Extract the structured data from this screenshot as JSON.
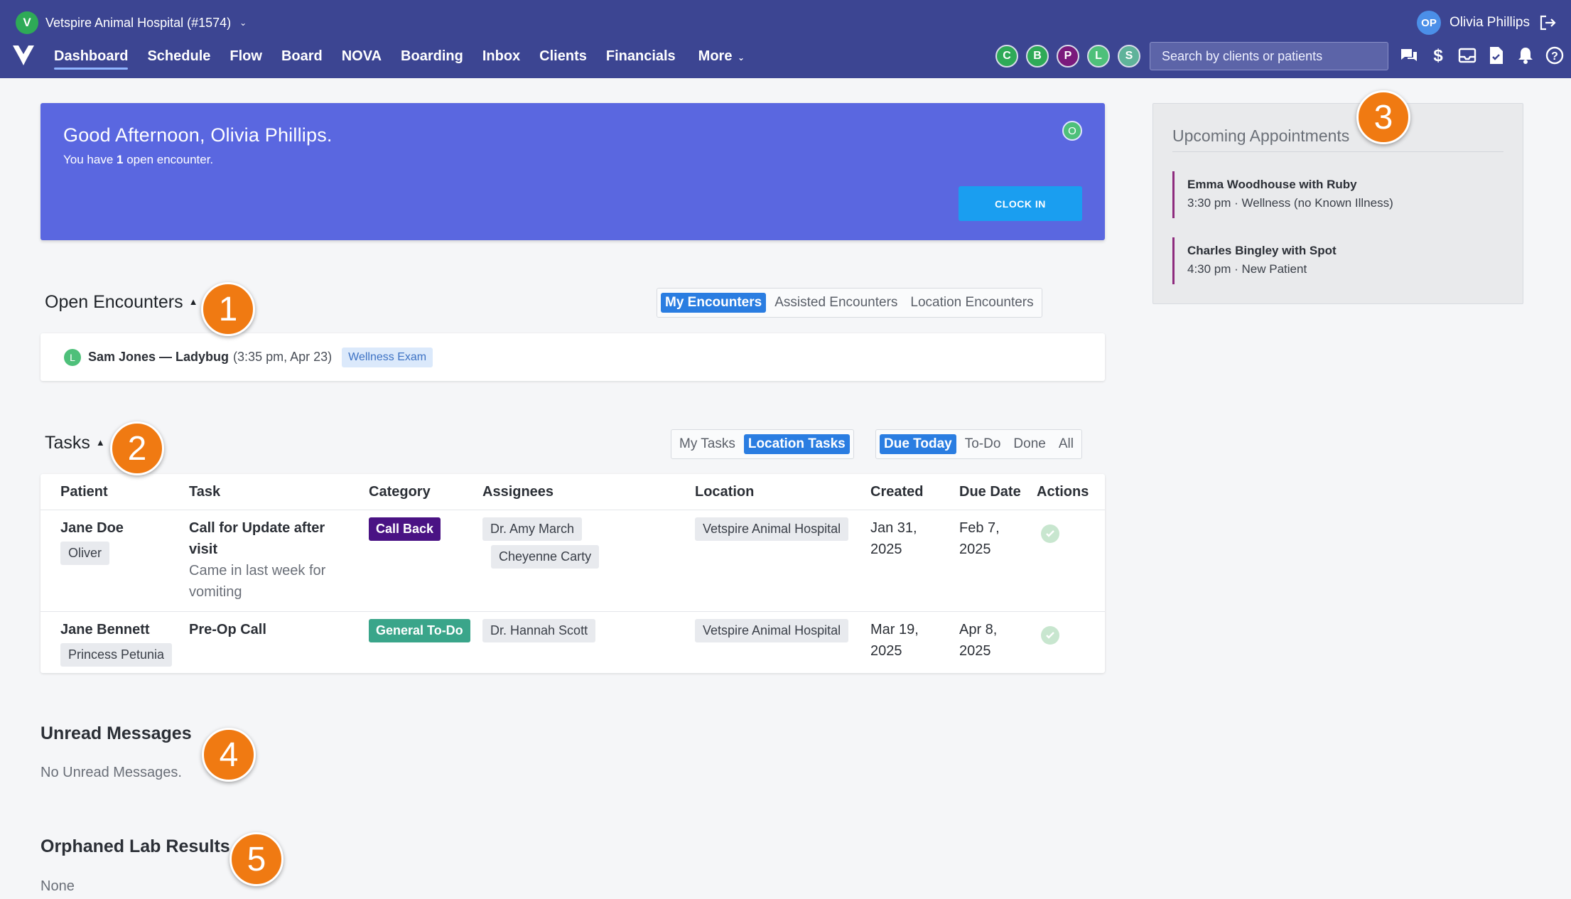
{
  "header": {
    "hospital_initial": "V",
    "hospital_name": "Vetspire Animal Hospital (#1574)",
    "user_initials": "OP",
    "user_name": "Olivia Phillips",
    "nav": [
      {
        "label": "Dashboard",
        "active": true
      },
      {
        "label": "Schedule"
      },
      {
        "label": "Flow"
      },
      {
        "label": "Board"
      },
      {
        "label": "NOVA"
      },
      {
        "label": "Boarding"
      },
      {
        "label": "Inbox"
      },
      {
        "label": "Clients"
      },
      {
        "label": "Financials"
      },
      {
        "label": "More"
      }
    ],
    "status_circles": [
      {
        "letter": "C",
        "color": "#2eaa57"
      },
      {
        "letter": "B",
        "color": "#2eaa57"
      },
      {
        "letter": "P",
        "color": "#7a1a7c"
      },
      {
        "letter": "L",
        "color": "#4ec07a"
      },
      {
        "letter": "S",
        "color": "#5fb39a"
      }
    ],
    "search_placeholder": "Search by clients or patients",
    "icons": [
      "chat-icon",
      "dollar-icon",
      "inbox-icon",
      "document-check-icon",
      "bell-icon",
      "help-icon"
    ]
  },
  "banner": {
    "greeting": "Good Afternoon, Olivia Phillips.",
    "open_prefix": "You have",
    "open_count": "1",
    "open_suffix": "open encounter.",
    "status_initial": "O",
    "clock_in": "CLOCK IN"
  },
  "encounters": {
    "title": "Open Encounters",
    "filters": [
      {
        "label": "My Encounters",
        "on": true
      },
      {
        "label": "Assisted Encounters"
      },
      {
        "label": "Location Encounters"
      }
    ],
    "item": {
      "initial": "L",
      "name": "Sam Jones — Ladybug",
      "time": "(3:35 pm, Apr 23)",
      "tag": "Wellness Exam"
    }
  },
  "tasks": {
    "title": "Tasks",
    "scope_filters": [
      {
        "label": "My Tasks"
      },
      {
        "label": "Location Tasks",
        "on": true
      }
    ],
    "due_filters": [
      {
        "label": "Due Today",
        "on": true
      },
      {
        "label": "To-Do"
      },
      {
        "label": "Done"
      },
      {
        "label": "All"
      }
    ],
    "columns": [
      "Patient",
      "Task",
      "Category",
      "Assignees",
      "Location",
      "Created",
      "Due Date",
      "Actions"
    ],
    "rows": [
      {
        "client": "Jane Doe",
        "patient": "Oliver",
        "task": "Call for Update after visit",
        "note": "Came in last week for vomiting",
        "category": "Call Back",
        "category_color": "#4a1384",
        "assignees": [
          "Dr. Amy March",
          "Cheyenne Carty"
        ],
        "location": "Vetspire Animal Hospital",
        "created": "Jan 31, 2025",
        "due": "Feb 7, 2025"
      },
      {
        "client": "Jane Bennett",
        "patient": "Princess Petunia",
        "task": "Pre-Op Call",
        "note": "",
        "category": "General To-Do",
        "category_color": "#3aa58a",
        "assignees": [
          "Dr. Hannah Scott"
        ],
        "location": "Vetspire Animal Hospital",
        "created": "Mar 19, 2025",
        "due": "Apr 8, 2025"
      }
    ]
  },
  "messages": {
    "title": "Unread Messages",
    "empty": "No Unread Messages."
  },
  "lab": {
    "title": "Orphaned Lab Results",
    "empty": "None"
  },
  "appointments": {
    "title": "Upcoming Appointments",
    "items": [
      {
        "name": "Emma Woodhouse with Ruby",
        "meta": "3:30 pm · Wellness (no Known Illness)"
      },
      {
        "name": "Charles Bingley with Spot",
        "meta": "4:30 pm · New Patient"
      }
    ]
  },
  "callouts": [
    "1",
    "2",
    "3",
    "4",
    "5"
  ],
  "colors": {
    "topbar": "#3c4592",
    "banner": "#5a67e0",
    "accent": "#2a7de1",
    "clock_in": "#1a9ef0",
    "callout": "#f07a12"
  }
}
